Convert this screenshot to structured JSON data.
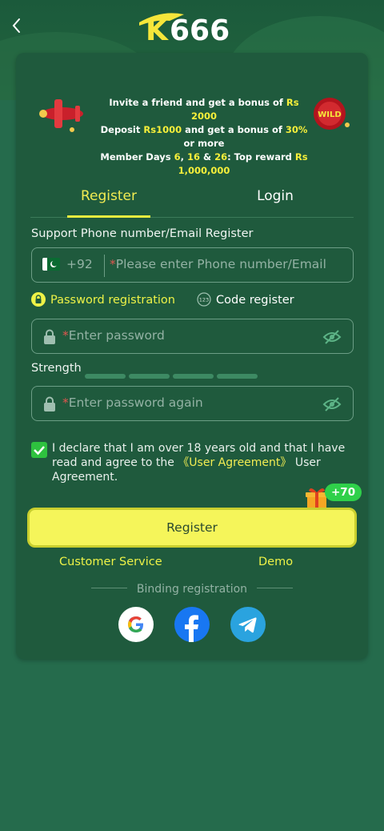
{
  "header": {
    "logo_text": "K666"
  },
  "banner": {
    "line1_pre": "Invite a friend and get a bonus of ",
    "line1_amount": "Rs 2000",
    "line2_a": "Deposit ",
    "line2_amount": "Rs1000",
    "line2_b": " and get a bonus of ",
    "line2_percent": "30%",
    "line2_c": " or more",
    "line3_a": "Member Days ",
    "line3_d1": "6",
    "line3_sep1": ", ",
    "line3_d2": "16",
    "line3_sep2": " & ",
    "line3_d3": "26",
    "line3_b": ": Top reward ",
    "line3_amount": "Rs 1,000,000",
    "wild_label": "WILD"
  },
  "tabs": {
    "register": "Register",
    "login": "Login"
  },
  "form": {
    "support_label": "Support Phone number/Email Register",
    "country_code": "+92",
    "required_mark": "*",
    "phone_placeholder": "Please enter Phone number/Email",
    "mode_password": "Password registration",
    "mode_code": "Code register",
    "code_icon_text": "123",
    "password_placeholder": "Enter password",
    "strength_label": "Strength",
    "password_again_placeholder": "Enter password again",
    "agree_pre": "I declare that I am over 18 years old and that I have read and agree to the ",
    "agree_link": "《User Agreement》",
    "agree_post": " User Agreement.",
    "bonus_badge": "+70",
    "register_button": "Register"
  },
  "footer": {
    "customer_service": "Customer Service",
    "demo": "Demo",
    "binding": "Binding registration"
  },
  "colors": {
    "accent": "#f2ec52",
    "background": "#256b4c",
    "card": "#1f5a3d",
    "button": "#f5f55a"
  }
}
